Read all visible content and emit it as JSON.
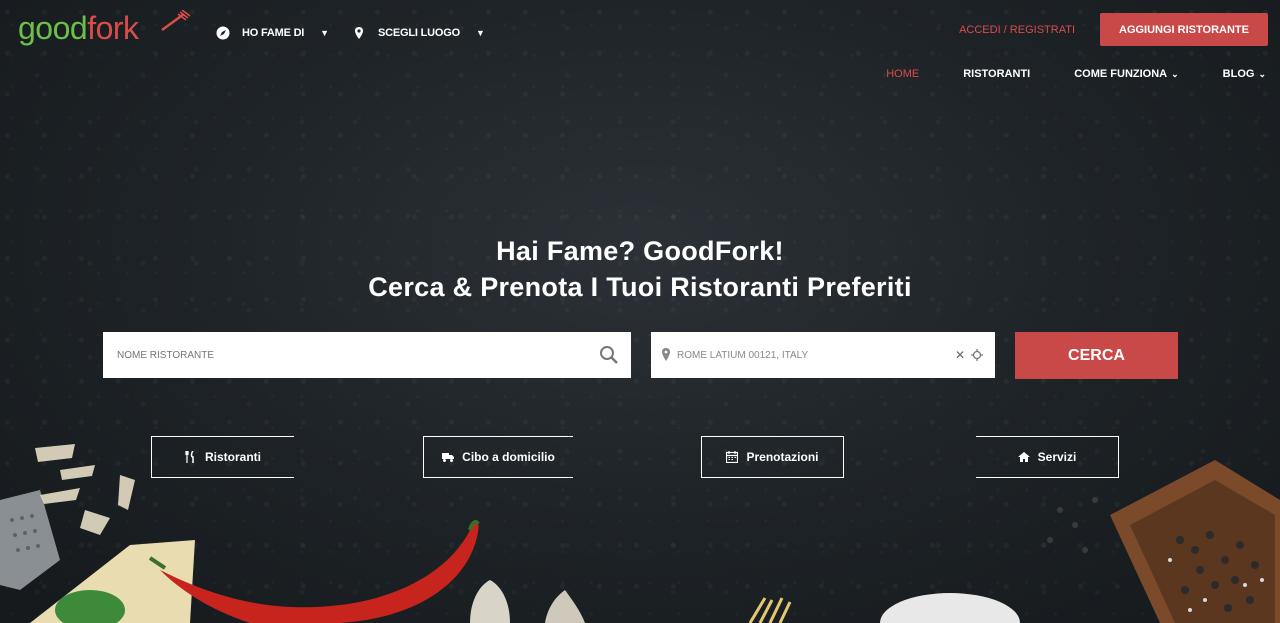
{
  "header": {
    "logo_good": "good",
    "logo_fork": "fork",
    "hungry_label": "HO FAME DI",
    "place_label": "SCEGLI LUOGO",
    "login_label": "ACCEDI / REGISTRATI",
    "add_restaurant_label": "AGGIUNGI RISTORANTE"
  },
  "nav": {
    "items": [
      {
        "label": "HOME",
        "active": true
      },
      {
        "label": "RISTORANTI"
      },
      {
        "label": "COME FUNZIONA",
        "dropdown": true
      },
      {
        "label": "BLOG",
        "dropdown": true
      }
    ]
  },
  "hero": {
    "title_line1": "Hai Fame? GoodFork!",
    "title_line2": "Cerca & Prenota I Tuoi Ristoranti Preferiti"
  },
  "search": {
    "name_placeholder": "NOME RISTORANTE",
    "location_value": "ROME LATIUM 00121, ITALY",
    "button_label": "CERCA"
  },
  "categories": [
    {
      "label": "Ristoranti",
      "icon": "cutlery-icon"
    },
    {
      "label": "Cibo a domicilio",
      "icon": "truck-icon"
    },
    {
      "label": "Prenotazioni",
      "icon": "calendar-icon"
    },
    {
      "label": "Servizi",
      "icon": "home-icon"
    }
  ],
  "colors": {
    "accent_red": "#c94848",
    "logo_green": "#6cc04a",
    "background": "#1d2226"
  }
}
